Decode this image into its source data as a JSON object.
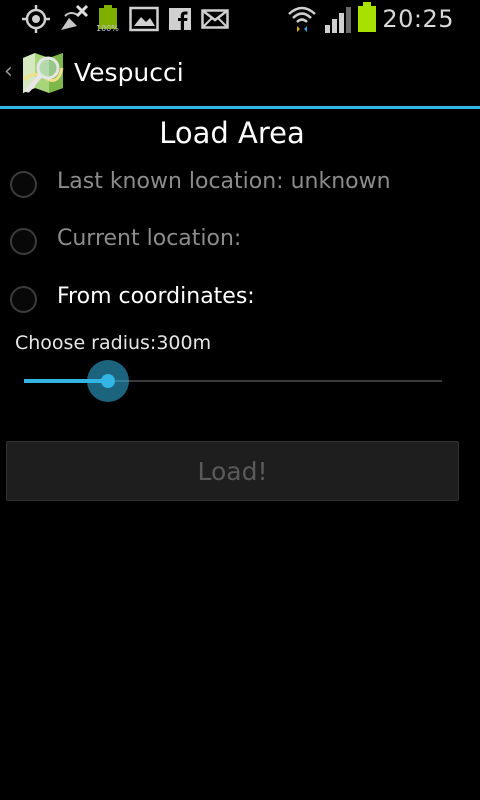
{
  "status_bar": {
    "time": "20:25",
    "battery_percent": "100%",
    "icons": [
      "gps-icon",
      "satellite-off-icon",
      "battery-full-icon",
      "gallery-icon",
      "facebook-icon",
      "email-icon",
      "wifi-icon",
      "signal-icon",
      "battery-charging-icon"
    ]
  },
  "action_bar": {
    "app_title": "Vespucci"
  },
  "dialog": {
    "title": "Load Area",
    "options": [
      {
        "label": "Last known location: unknown",
        "enabled": false
      },
      {
        "label": "Current location:",
        "enabled": false
      },
      {
        "label": "From coordinates:",
        "enabled": true
      }
    ],
    "radius_label": "Choose radius:300m",
    "slider_fraction": 0.2,
    "load_button": "Load!"
  },
  "colors": {
    "accent": "#33b5e5",
    "background": "#000000"
  }
}
